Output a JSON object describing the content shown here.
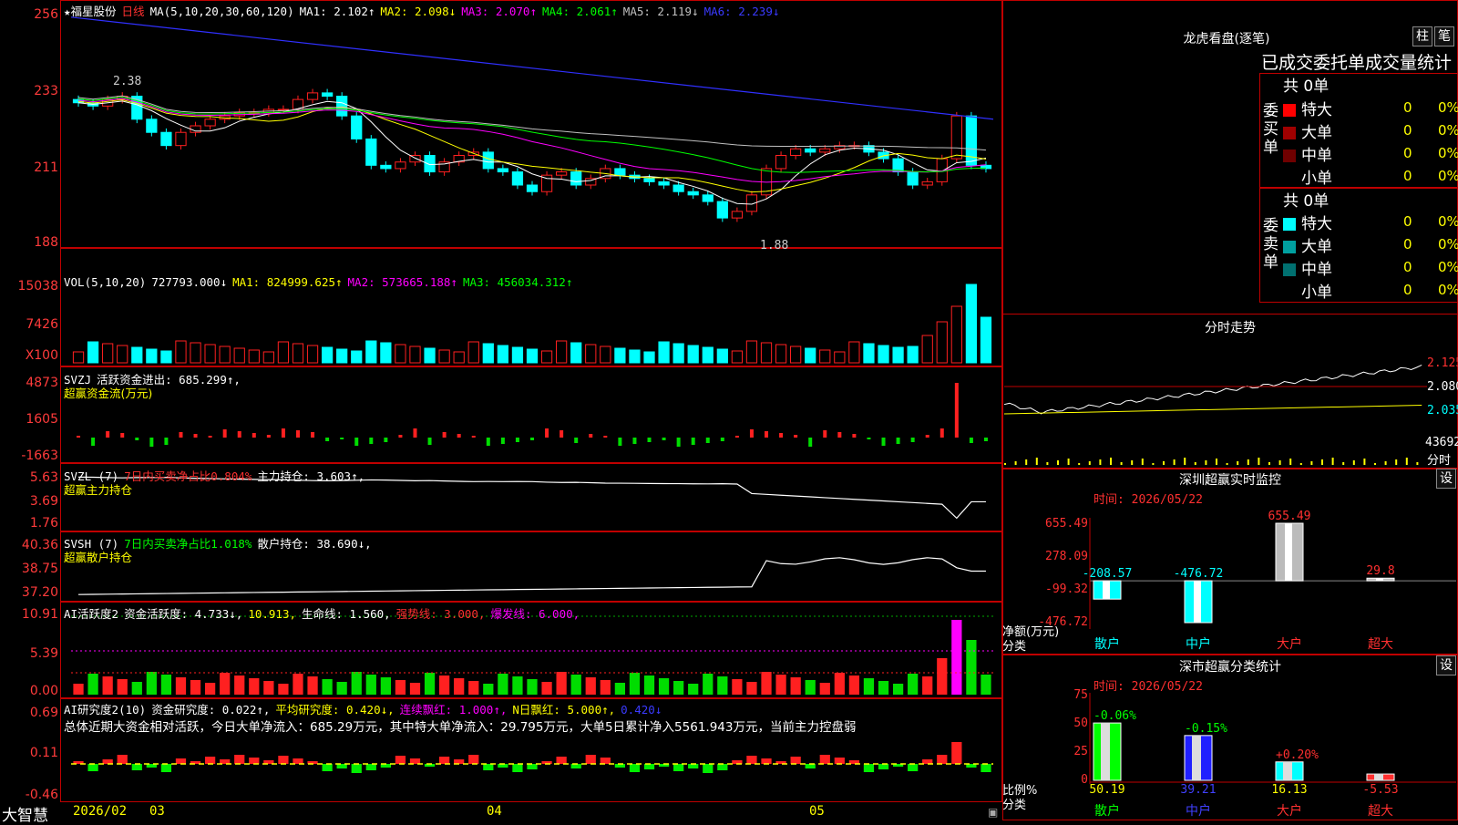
{
  "stock": {
    "star": "★",
    "name": "福星股份",
    "period": "日线"
  },
  "kline": {
    "ma_header": "MA(5,10,20,30,60,120)",
    "ma": [
      {
        "label": "MA1: 2.102↑",
        "color": "#ffffff"
      },
      {
        "label": "MA2: 2.098↓",
        "color": "#ffff00"
      },
      {
        "label": "MA3: 2.070↑",
        "color": "#ff00ff"
      },
      {
        "label": "MA4: 2.061↑",
        "color": "#00ff00"
      },
      {
        "label": "MA5: 2.119↓",
        "color": "#c0c0c0"
      },
      {
        "label": "MA6: 2.239↓",
        "color": "#3030ff"
      }
    ],
    "yticks": [
      "256",
      "233",
      "211",
      "188"
    ],
    "high_label": "2.38",
    "low_label": "1.88",
    "close": [
      2.29,
      2.28,
      2.3,
      2.31,
      2.24,
      2.2,
      2.16,
      2.2,
      2.22,
      2.24,
      2.25,
      2.26,
      2.26,
      2.27,
      2.27,
      2.3,
      2.32,
      2.31,
      2.25,
      2.18,
      2.1,
      2.09,
      2.11,
      2.13,
      2.08,
      2.11,
      2.13,
      2.14,
      2.09,
      2.08,
      2.04,
      2.02,
      2.07,
      2.08,
      2.04,
      2.06,
      2.09,
      2.07,
      2.06,
      2.05,
      2.04,
      2.02,
      2.01,
      1.99,
      1.94,
      1.96,
      2.01,
      2.09,
      2.13,
      2.15,
      2.14,
      2.15,
      2.16,
      2.16,
      2.14,
      2.12,
      2.08,
      2.04,
      2.05,
      2.12,
      2.25,
      2.1,
      2.09
    ]
  },
  "vol": {
    "header": "VOL(5,10,20)",
    "value": "727793.000↓",
    "ma": [
      {
        "label": "MA1: 824999.625↑",
        "color": "#ffff00"
      },
      {
        "label": "MA2: 573665.188↑",
        "color": "#ff00ff"
      },
      {
        "label": "MA3: 456034.312↑",
        "color": "#00ff00"
      }
    ],
    "yticks": [
      "15038",
      "7426",
      "X100"
    ]
  },
  "svzj": {
    "header": "SVZJ",
    "label": "活跃资金进出: 685.299↑,",
    "sub": "超赢资金流(万元)",
    "yticks": [
      "4873",
      "1605",
      "-1663"
    ]
  },
  "svzl": {
    "header": "SVZL (7)",
    "label1": "7日内买卖净占比0.804%",
    "label2": "主力持仓: 3.603↑,",
    "sub": "超赢主力持仓",
    "yticks": [
      "5.63",
      "3.69",
      "1.76"
    ]
  },
  "svsh": {
    "header": "SVSH (7)",
    "label1": "7日内买卖净占比1.018%",
    "label2": "散户持仓: 38.690↓,",
    "sub": "超赢散户持仓",
    "yticks": [
      "40.36",
      "38.75",
      "37.20"
    ]
  },
  "ai1": {
    "header": "AI活跃度2",
    "label1": "资金活跃度: 4.733↓,",
    "label2": "10.913,",
    "label3": "生命线: 1.560,",
    "label4": "强势线: 3.000,",
    "label5": "爆发线: 6.000,",
    "yticks": [
      "10.91",
      "5.39",
      "0.00"
    ]
  },
  "ai2": {
    "header": "AI研究度2(10)",
    "label1": "资金研究度: 0.022↑,",
    "label2": "平均研究度: 0.420↓,",
    "label3": "连续飘红: 1.000↑,",
    "label4": "N日飘红: 5.000↑,",
    "label5": "0.420↓",
    "summary": "总体近期大资金相对活跃，今日大单净流入：685.29万元，其中特大单净流入：29.795万元，大单5日累计净入5561.943万元，当前主力控盘弱",
    "yticks": [
      "0.69",
      "0.11",
      "-0.46"
    ]
  },
  "bottom": {
    "brand": "大智慧",
    "date": "2026/02",
    "m3": "03",
    "m4": "04",
    "m5": "05"
  },
  "right": {
    "dragon_title": "龙虎看盘(逐笔)",
    "btn1": "柱",
    "btn2": "笔",
    "stats_title": "已成交委托单成交量统计",
    "buy": {
      "side": "委买单",
      "total": "共 0单",
      "rows": [
        {
          "label": "特大",
          "count": "0",
          "pct": "0%",
          "color": "#ff0000"
        },
        {
          "label": "大单",
          "count": "0",
          "pct": "0%",
          "color": "#a00000"
        },
        {
          "label": "中单",
          "count": "0",
          "pct": "0%",
          "color": "#700000"
        },
        {
          "label": "小单",
          "count": "0",
          "pct": "0%",
          "color": "#000000"
        }
      ]
    },
    "sell": {
      "side": "委卖单",
      "total": "共 0单",
      "rows": [
        {
          "label": "特大",
          "count": "0",
          "pct": "0%",
          "color": "#00ffff"
        },
        {
          "label": "大单",
          "count": "0",
          "pct": "0%",
          "color": "#00a0a0"
        },
        {
          "label": "中单",
          "count": "0",
          "pct": "0%",
          "color": "#007070"
        },
        {
          "label": "小单",
          "count": "0",
          "pct": "0%",
          "color": "#000000"
        }
      ]
    },
    "fenshi": {
      "title": "分时走势",
      "yticks": [
        "2.125",
        "2.080",
        "2.035"
      ],
      "vol": "43692",
      "vol_unit": "分时"
    },
    "monitor": {
      "title": "深圳超赢实时监控",
      "set": "设",
      "time": "时间: 2026/05/22",
      "yticks": [
        "655.49",
        "278.09",
        "-99.32",
        "-476.72"
      ],
      "ylabel": "净额(万元)",
      "xlabel": "分类",
      "bars": [
        {
          "cat": "散户",
          "value": -208.57,
          "label": "-208.57"
        },
        {
          "cat": "中户",
          "value": -476.72,
          "label": "-476.72"
        },
        {
          "cat": "大户",
          "value": 655.49,
          "label": "655.49"
        },
        {
          "cat": "超大",
          "value": 29.8,
          "label": "29.8"
        }
      ]
    },
    "classify": {
      "title": "深市超赢分类统计",
      "set": "设",
      "time": "时间: 2026/05/22",
      "yticks": [
        "75",
        "50",
        "25",
        "0"
      ],
      "ylabel": "比例%",
      "xlabel": "分类",
      "bars": [
        {
          "cat": "散户",
          "value": 50.19,
          "label": "50.19",
          "delta": "-0.06%"
        },
        {
          "cat": "中户",
          "value": 39.21,
          "label": "39.21",
          "delta": "-0.15%"
        },
        {
          "cat": "大户",
          "value": 16.13,
          "label": "16.13",
          "delta": "+0.20%"
        },
        {
          "cat": "超大",
          "value": 5.53,
          "label": "-5.53",
          "delta": ""
        }
      ]
    }
  },
  "colors": {
    "up": "#ff2020",
    "down": "#00ffff",
    "grid": "#c00000",
    "accent": "#ffff00"
  }
}
